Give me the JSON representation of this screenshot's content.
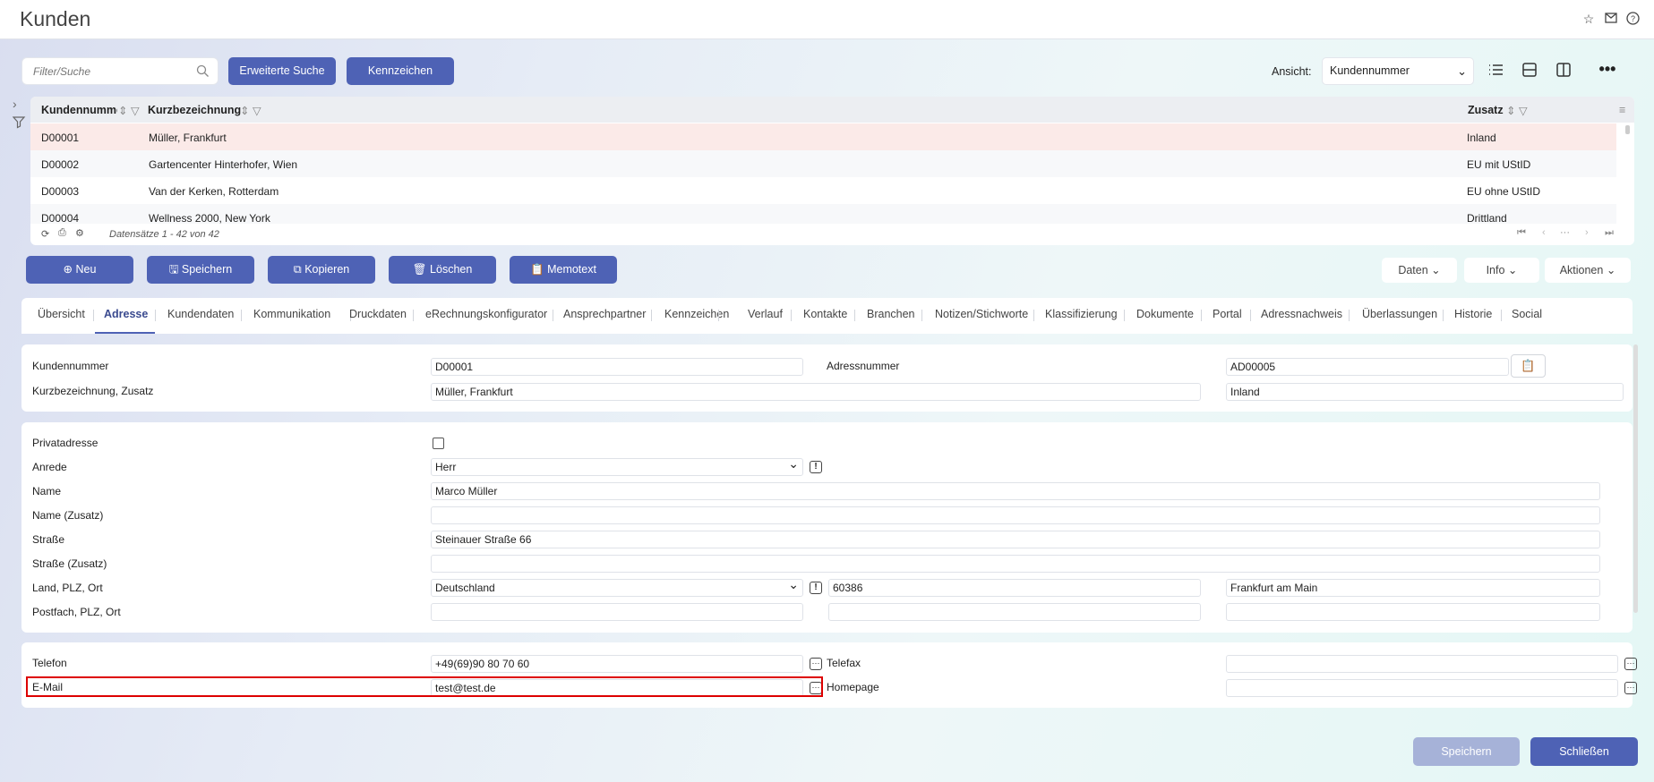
{
  "header": {
    "title": "Kunden",
    "icons": [
      "star-icon",
      "mail-icon",
      "help-icon"
    ]
  },
  "toolbar": {
    "search_placeholder": "Filter/Suche",
    "extended_search": "Erweiterte Suche",
    "kennzeichen": "Kennzeichen",
    "ansicht_label": "Ansicht:",
    "ansicht_value": "Kundennummer"
  },
  "grid": {
    "columns": [
      "Kundennumme",
      "Kurzbezeichnung",
      "Zusatz"
    ],
    "rows": [
      {
        "nr": "D00001",
        "name": "Müller, Frankfurt",
        "zusatz": "Inland"
      },
      {
        "nr": "D00002",
        "name": "Gartencenter Hinterhofer, Wien",
        "zusatz": "EU mit UStID"
      },
      {
        "nr": "D00003",
        "name": "Van der Kerken, Rotterdam",
        "zusatz": "EU ohne UStID"
      },
      {
        "nr": "D00004",
        "name": "Wellness 2000, New York",
        "zusatz": "Drittland"
      }
    ],
    "footer": "Datensätze 1 - 42 von 42"
  },
  "actions": {
    "neu": "Neu",
    "speichern": "Speichern",
    "kopieren": "Kopieren",
    "loeschen": "Löschen",
    "memotext": "Memotext",
    "daten": "Daten",
    "info": "Info",
    "aktionen": "Aktionen"
  },
  "tabs": [
    "Übersicht",
    "Adresse",
    "Kundendaten",
    "Kommunikation",
    "Druckdaten",
    "eRechnungskonfigurator",
    "Ansprechpartner",
    "Kennzeichen",
    "Verlauf",
    "Kontakte",
    "Branchen",
    "Notizen/Stichworte",
    "Klassifizierung",
    "Dokumente",
    "Portal",
    "Adressnachweis",
    "Überlassungen",
    "Historie",
    "Social"
  ],
  "form": {
    "kundennummer_label": "Kundennummer",
    "kundennummer": "D00001",
    "adressnummer_label": "Adressnummer",
    "adressnummer": "AD00005",
    "kurzbez_label": "Kurzbezeichnung, Zusatz",
    "kurzbez": "Müller, Frankfurt",
    "zusatz": "Inland",
    "privat_label": "Privatadresse",
    "anrede_label": "Anrede",
    "anrede": "Herr",
    "name_label": "Name",
    "name": "Marco Müller",
    "name_zusatz_label": "Name (Zusatz)",
    "strasse_label": "Straße",
    "strasse": "Steinauer Straße 66",
    "strasse_zusatz_label": "Straße (Zusatz)",
    "land_label": "Land, PLZ, Ort",
    "land": "Deutschland",
    "plz": "60386",
    "ort": "Frankfurt am Main",
    "postfach_label": "Postfach, PLZ, Ort",
    "telefon_label": "Telefon",
    "telefon": "+49(69)90 80 70 60",
    "telefax_label": "Telefax",
    "email_label": "E-Mail",
    "email": "test@test.de",
    "homepage_label": "Homepage"
  },
  "footer_buttons": {
    "speichern": "Speichern",
    "schliessen": "Schließen"
  },
  "colors": {
    "primary": "#4e62b5",
    "highlight": "#dd0000",
    "selected_row": "#fbeae8"
  }
}
